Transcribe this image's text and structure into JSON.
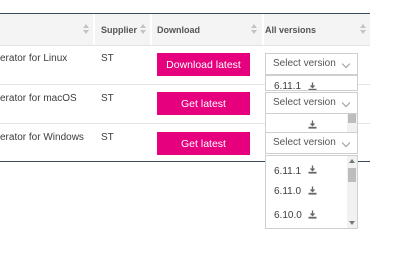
{
  "table": {
    "headers": {
      "supplier": "Supplier",
      "download": "Download",
      "all_versions": "All versions"
    },
    "rows": [
      {
        "name": "erator for Linux",
        "supplier": "ST",
        "button": "Download latest",
        "select": "Select version"
      },
      {
        "name": "erator for macOS",
        "supplier": "ST",
        "button": "Get latest",
        "select": "Select version"
      },
      {
        "name": "erator for Windows",
        "supplier": "ST",
        "button": "Get latest",
        "select": "Select version"
      }
    ]
  },
  "dropdown_row1": {
    "items": [
      "6.11.1"
    ]
  },
  "dropdown_row3": {
    "items": [
      "6.11.1",
      "6.11.0",
      "6.10.0"
    ]
  },
  "colors": {
    "accent": "#e6007e",
    "rule": "#3a4a5a"
  },
  "icons": {
    "download": "download-icon",
    "chevron": "chevron-down-icon"
  }
}
